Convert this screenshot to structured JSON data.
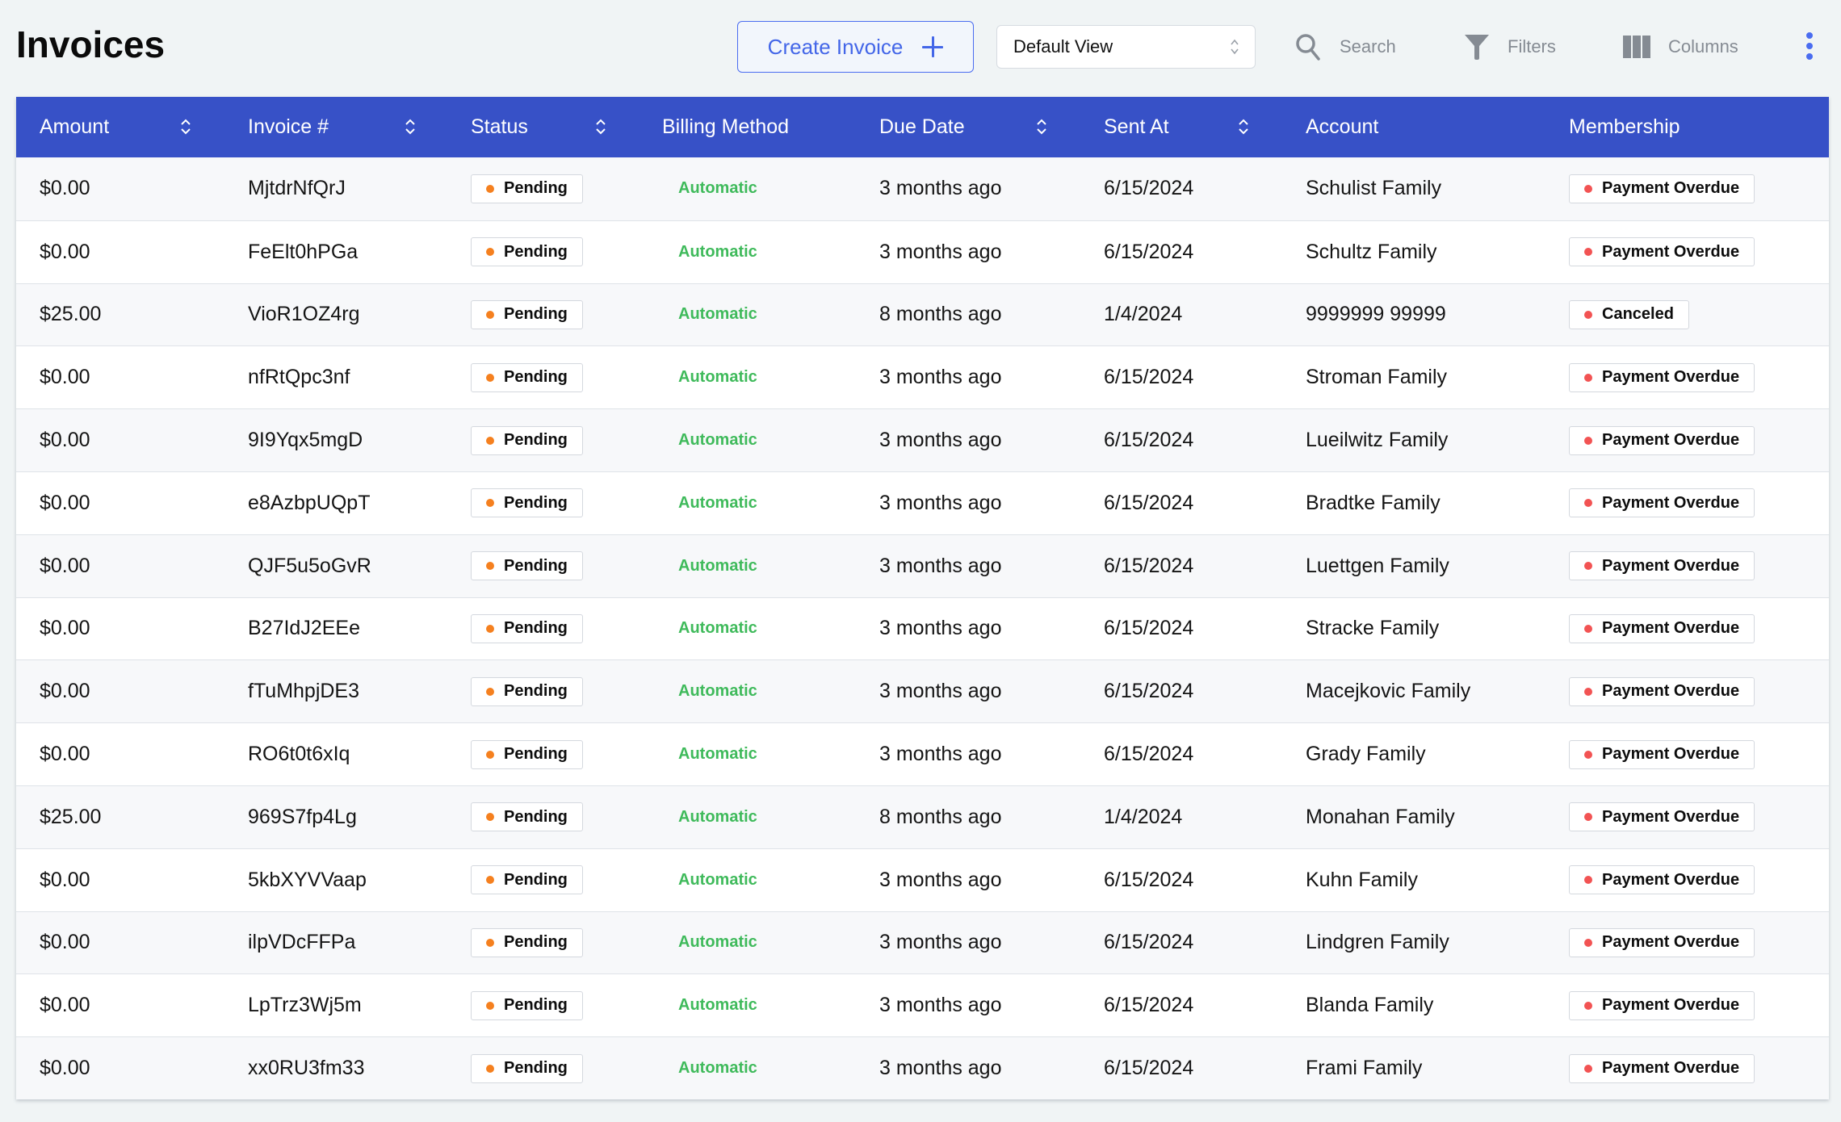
{
  "page": {
    "title": "Invoices"
  },
  "toolbar": {
    "create_label": "Create Invoice",
    "view_select_value": "Default View",
    "search_label": "Search",
    "filters_label": "Filters",
    "columns_label": "Columns",
    "icons": {
      "create": "plus-icon",
      "view": "chevron-up-down-icon",
      "search": "search-icon",
      "filters": "filter-icon",
      "columns": "columns-icon",
      "more": "kebab-menu-icon"
    }
  },
  "colors": {
    "header_bg": "#3751c7",
    "accent": "#4366e8",
    "pending_dot": "#f5801f",
    "overdue_dot": "#f25353",
    "automatic_text": "#3fba5b",
    "toolbar_text": "#858b93"
  },
  "table": {
    "columns": [
      {
        "key": "amount",
        "label": "Amount",
        "sortable": true
      },
      {
        "key": "invoice",
        "label": "Invoice #",
        "sortable": true
      },
      {
        "key": "status",
        "label": "Status",
        "sortable": true
      },
      {
        "key": "billing",
        "label": "Billing Method",
        "sortable": false
      },
      {
        "key": "due",
        "label": "Due Date",
        "sortable": true
      },
      {
        "key": "sent",
        "label": "Sent At",
        "sortable": true
      },
      {
        "key": "account",
        "label": "Account",
        "sortable": false
      },
      {
        "key": "membership",
        "label": "Membership",
        "sortable": false
      }
    ],
    "rows": [
      {
        "amount": "$0.00",
        "invoice": "MjtdrNfQrJ",
        "status": "Pending",
        "billing": "Automatic",
        "due": "3 months ago",
        "sent": "6/15/2024",
        "account": "Schulist Family",
        "membership": "Payment Overdue"
      },
      {
        "amount": "$0.00",
        "invoice": "FeElt0hPGa",
        "status": "Pending",
        "billing": "Automatic",
        "due": "3 months ago",
        "sent": "6/15/2024",
        "account": "Schultz Family",
        "membership": "Payment Overdue"
      },
      {
        "amount": "$25.00",
        "invoice": "VioR1OZ4rg",
        "status": "Pending",
        "billing": "Automatic",
        "due": "8 months ago",
        "sent": "1/4/2024",
        "account": "9999999 99999",
        "membership": "Canceled"
      },
      {
        "amount": "$0.00",
        "invoice": "nfRtQpc3nf",
        "status": "Pending",
        "billing": "Automatic",
        "due": "3 months ago",
        "sent": "6/15/2024",
        "account": "Stroman Family",
        "membership": "Payment Overdue"
      },
      {
        "amount": "$0.00",
        "invoice": "9I9Yqx5mgD",
        "status": "Pending",
        "billing": "Automatic",
        "due": "3 months ago",
        "sent": "6/15/2024",
        "account": "Lueilwitz Family",
        "membership": "Payment Overdue"
      },
      {
        "amount": "$0.00",
        "invoice": "e8AzbpUQpT",
        "status": "Pending",
        "billing": "Automatic",
        "due": "3 months ago",
        "sent": "6/15/2024",
        "account": "Bradtke Family",
        "membership": "Payment Overdue"
      },
      {
        "amount": "$0.00",
        "invoice": "QJF5u5oGvR",
        "status": "Pending",
        "billing": "Automatic",
        "due": "3 months ago",
        "sent": "6/15/2024",
        "account": "Luettgen Family",
        "membership": "Payment Overdue"
      },
      {
        "amount": "$0.00",
        "invoice": "B27IdJ2EEe",
        "status": "Pending",
        "billing": "Automatic",
        "due": "3 months ago",
        "sent": "6/15/2024",
        "account": "Stracke Family",
        "membership": "Payment Overdue"
      },
      {
        "amount": "$0.00",
        "invoice": "fTuMhpjDE3",
        "status": "Pending",
        "billing": "Automatic",
        "due": "3 months ago",
        "sent": "6/15/2024",
        "account": "Macejkovic Family",
        "membership": "Payment Overdue"
      },
      {
        "amount": "$0.00",
        "invoice": "RO6t0t6xIq",
        "status": "Pending",
        "billing": "Automatic",
        "due": "3 months ago",
        "sent": "6/15/2024",
        "account": "Grady Family",
        "membership": "Payment Overdue"
      },
      {
        "amount": "$25.00",
        "invoice": "969S7fp4Lg",
        "status": "Pending",
        "billing": "Automatic",
        "due": "8 months ago",
        "sent": "1/4/2024",
        "account": "Monahan Family",
        "membership": "Payment Overdue"
      },
      {
        "amount": "$0.00",
        "invoice": "5kbXYVVaap",
        "status": "Pending",
        "billing": "Automatic",
        "due": "3 months ago",
        "sent": "6/15/2024",
        "account": "Kuhn Family",
        "membership": "Payment Overdue"
      },
      {
        "amount": "$0.00",
        "invoice": "ilpVDcFFPa",
        "status": "Pending",
        "billing": "Automatic",
        "due": "3 months ago",
        "sent": "6/15/2024",
        "account": "Lindgren Family",
        "membership": "Payment Overdue"
      },
      {
        "amount": "$0.00",
        "invoice": "LpTrz3Wj5m",
        "status": "Pending",
        "billing": "Automatic",
        "due": "3 months ago",
        "sent": "6/15/2024",
        "account": "Blanda Family",
        "membership": "Payment Overdue"
      },
      {
        "amount": "$0.00",
        "invoice": "xx0RU3fm33",
        "status": "Pending",
        "billing": "Automatic",
        "due": "3 months ago",
        "sent": "6/15/2024",
        "account": "Frami Family",
        "membership": "Payment Overdue"
      }
    ]
  }
}
